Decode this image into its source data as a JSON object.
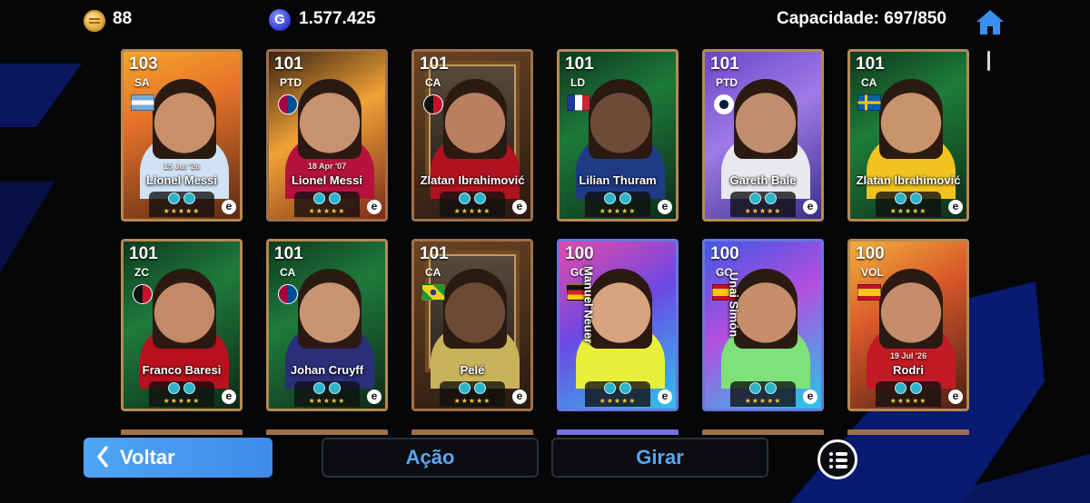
{
  "header": {
    "coins": "88",
    "gp": "1.577.425",
    "gp_symbol": "G",
    "capacity_label": "Capacidade: 697/850",
    "home_icon": "home-icon"
  },
  "cards": [
    {
      "rating": "103",
      "position": "SA",
      "marker": "flag-argentina",
      "date": "15 Jul '26",
      "name": "Lionel Messi"
    },
    {
      "rating": "101",
      "position": "PTD",
      "marker": "club-barcelona",
      "date": "18 Apr '07",
      "name": "Lionel Messi"
    },
    {
      "rating": "101",
      "position": "CA",
      "marker": "club-milan",
      "date": "",
      "name": "Zlatan Ibrahimović"
    },
    {
      "rating": "101",
      "position": "LD",
      "marker": "flag-france",
      "date": "",
      "name": "Lilian Thuram"
    },
    {
      "rating": "101",
      "position": "PTD",
      "marker": "club-tottenham",
      "date": "",
      "name": "Gareth Bale"
    },
    {
      "rating": "101",
      "position": "CA",
      "marker": "flag-sweden",
      "date": "",
      "name": "Zlatan Ibrahimović"
    },
    {
      "rating": "101",
      "position": "ZC",
      "marker": "club-milan",
      "date": "",
      "name": "Franco Baresi"
    },
    {
      "rating": "101",
      "position": "CA",
      "marker": "club-barcelona",
      "date": "",
      "name": "Johan Cruyff"
    },
    {
      "rating": "101",
      "position": "CA",
      "marker": "flag-brazil",
      "date": "",
      "name": "Pelé"
    },
    {
      "rating": "100",
      "position": "GO",
      "marker": "flag-germany",
      "date": "",
      "name": "Manuel Neuer"
    },
    {
      "rating": "100",
      "position": "GO",
      "marker": "flag-spain",
      "date": "",
      "name": "Unai Simón"
    },
    {
      "rating": "100",
      "position": "VOL",
      "marker": "flag-spain",
      "date": "19 Jul '26",
      "name": "Rodri"
    }
  ],
  "card_badge": "e",
  "card_stars": "★★★★★",
  "footer": {
    "back_label": "Voltar",
    "action_label": "Ação",
    "rotate_label": "Girar",
    "menu_icon": "list-menu-icon"
  },
  "colors": {
    "accent_blue": "#4ea5f4",
    "button_text": "#5aa6f2",
    "background": "#050608"
  }
}
